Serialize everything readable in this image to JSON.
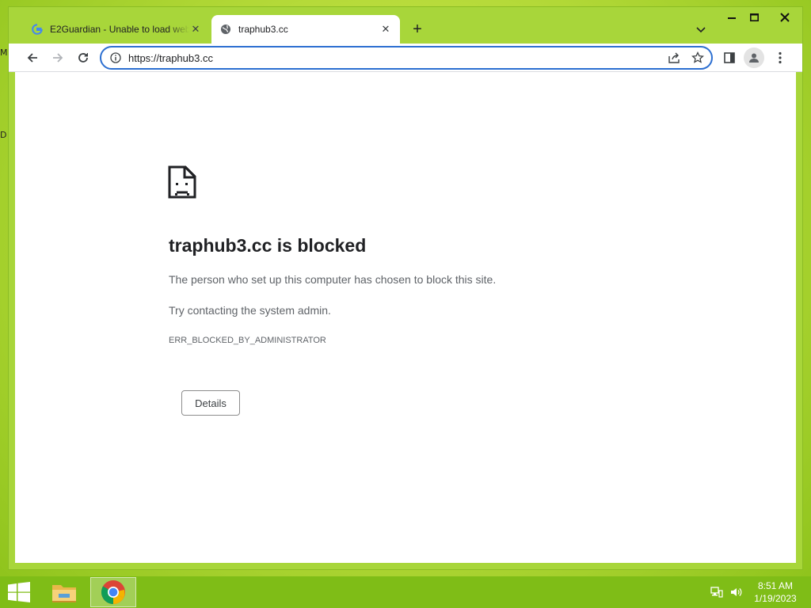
{
  "desktop": {
    "edge_text_1": "M",
    "edge_text_2": "D"
  },
  "browser": {
    "tabs": [
      {
        "title": "E2Guardian - Unable to load web",
        "favicon": "google-g-icon",
        "close_icon": "close-icon"
      },
      {
        "title": "traphub3.cc",
        "favicon": "globe-icon",
        "close_icon": "close-icon",
        "active": true
      }
    ],
    "new_tab_icon": "plus-icon",
    "tab_list_icon": "chevron-down-icon",
    "window_controls": [
      "minimize-icon",
      "maximize-icon",
      "close-icon"
    ],
    "nav": {
      "back_icon": "arrow-left-icon",
      "forward_icon": "arrow-right-icon",
      "reload_icon": "reload-icon"
    },
    "omnibox": {
      "value": "https://traphub3.cc",
      "info_icon": "info-icon",
      "share_icon": "share-icon",
      "bookmark_icon": "star-icon"
    },
    "toolbar_icons": [
      "side-panel-icon",
      "profile-icon",
      "kebab-menu-icon"
    ]
  },
  "page": {
    "icon": "sad-document-icon",
    "title": "traphub3.cc is blocked",
    "line1": "The person who set up this computer has chosen to block this site.",
    "line2": "Try contacting the system admin.",
    "error_code": "ERR_BLOCKED_BY_ADMINISTRATOR",
    "details_label": "Details"
  },
  "taskbar": {
    "start_icon": "windows-logo-icon",
    "apps": [
      "file-explorer-icon",
      "chrome-icon"
    ],
    "tray": [
      "network-icon",
      "volume-icon"
    ],
    "time": "8:51 AM",
    "date": "1/19/2023"
  },
  "colors": {
    "accent": "#2c6fd1",
    "window_frame": "#a8d63a",
    "taskbar": "#7fbd17",
    "page_bg": "#ffffff"
  }
}
